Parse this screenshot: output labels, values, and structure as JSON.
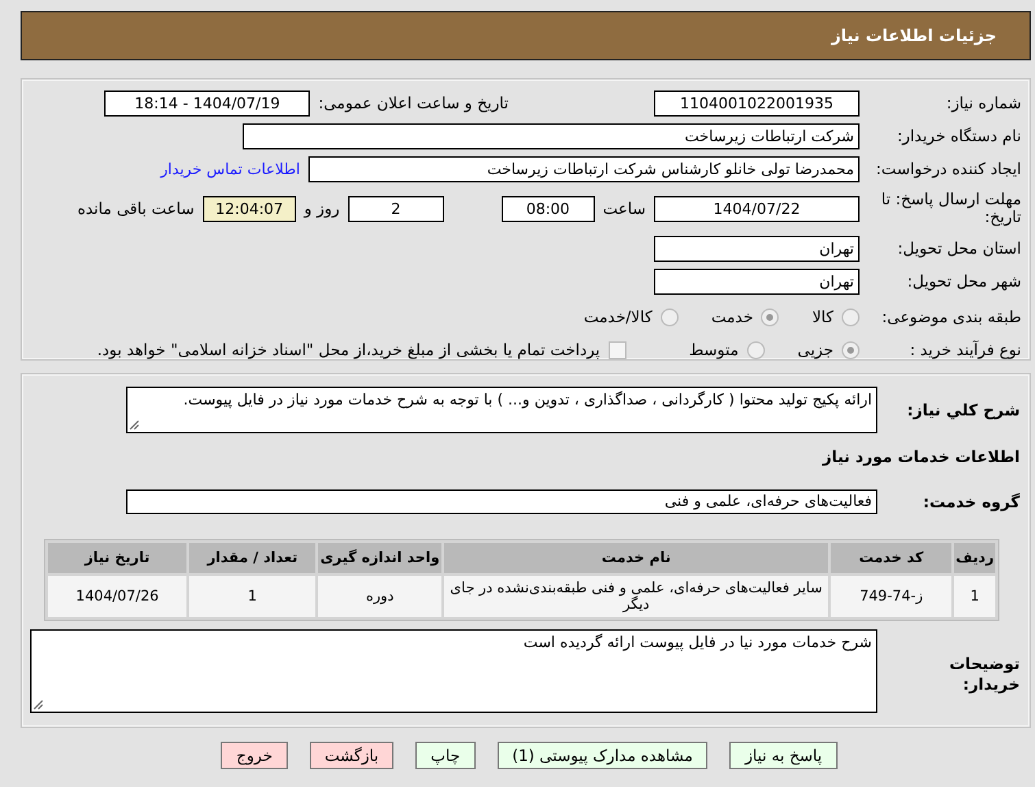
{
  "header": {
    "title": "جزئیات اطلاعات نیاز"
  },
  "details": {
    "need_number": {
      "label": "شماره نیاز:",
      "value": "1104001022001935"
    },
    "announce": {
      "label": "تاریخ و ساعت اعلان عمومی:",
      "value": "1404/07/19 - 18:14"
    },
    "buyer": {
      "label": "نام دستگاه خریدار:",
      "value": "شرکت ارتباطات زیرساخت"
    },
    "creator": {
      "label": "ایجاد کننده درخواست:",
      "value": "محمدرضا تولی خانلو کارشناس شرکت ارتباطات زیرساخت",
      "link": "اطلاعات تماس خریدار"
    },
    "deadline": {
      "label": "مهلت ارسال پاسخ: تا تاریخ:",
      "date": "1404/07/22",
      "time_label": "ساعت",
      "time": "08:00",
      "days": "2",
      "days_label": "روز و",
      "remaining": "12:04:07",
      "remaining_label": "ساعت باقی مانده"
    },
    "province": {
      "label": "استان محل تحویل:",
      "value": "تهران"
    },
    "city": {
      "label": "شهر محل تحویل:",
      "value": "تهران"
    },
    "category": {
      "label": "طبقه بندی موضوعی:",
      "options": [
        {
          "label": "کالا",
          "selected": false
        },
        {
          "label": "خدمت",
          "selected": true
        },
        {
          "label": "کالا/خدمت",
          "selected": false
        }
      ]
    },
    "process": {
      "label": "نوع فرآیند خرید :",
      "options": [
        {
          "label": "جزیی",
          "selected": true
        },
        {
          "label": "متوسط",
          "selected": false
        }
      ],
      "treasury": {
        "label": "پرداخت تمام یا بخشی از مبلغ خرید،از محل \"اسناد خزانه اسلامی\" خواهد بود.",
        "checked": false
      }
    }
  },
  "services": {
    "description": {
      "label": "شرح کلي نیاز:",
      "value": "ارائه پکیج تولید محتوا ( کارگردانی ، صداگذاری ، تدوین و... ) با توجه به شرح خدمات مورد نیاز در فایل پیوست."
    },
    "heading": "اطلاعات خدمات مورد نیاز",
    "group": {
      "label": "گروه خدمت:",
      "value": "فعالیت‌های حرفه‌ای، علمی و فنی"
    },
    "table": {
      "columns": [
        "ردیف",
        "کد خدمت",
        "نام خدمت",
        "واحد اندازه گیری",
        "تعداد / مقدار",
        "تاریخ نیاز"
      ],
      "rows": [
        [
          "1",
          "ز-74-749",
          "سایر فعالیت‌های حرفه‌ای، علمی و فنی طبقه‌بندی‌نشده در جای دیگر",
          "دوره",
          "1",
          "1404/07/26"
        ]
      ]
    },
    "notes": {
      "label": "توضیحات خریدار:",
      "value": "شرح خدمات مورد نیا در فایل پیوست ارائه گردیده است"
    }
  },
  "buttons": [
    {
      "label": "پاسخ به نیاز",
      "kind": "normal"
    },
    {
      "label": "مشاهده مدارک پیوستی (1)",
      "kind": "normal"
    },
    {
      "label": "چاپ",
      "kind": "normal"
    },
    {
      "label": "بازگشت",
      "kind": "danger"
    },
    {
      "label": "خروج",
      "kind": "danger"
    }
  ]
}
